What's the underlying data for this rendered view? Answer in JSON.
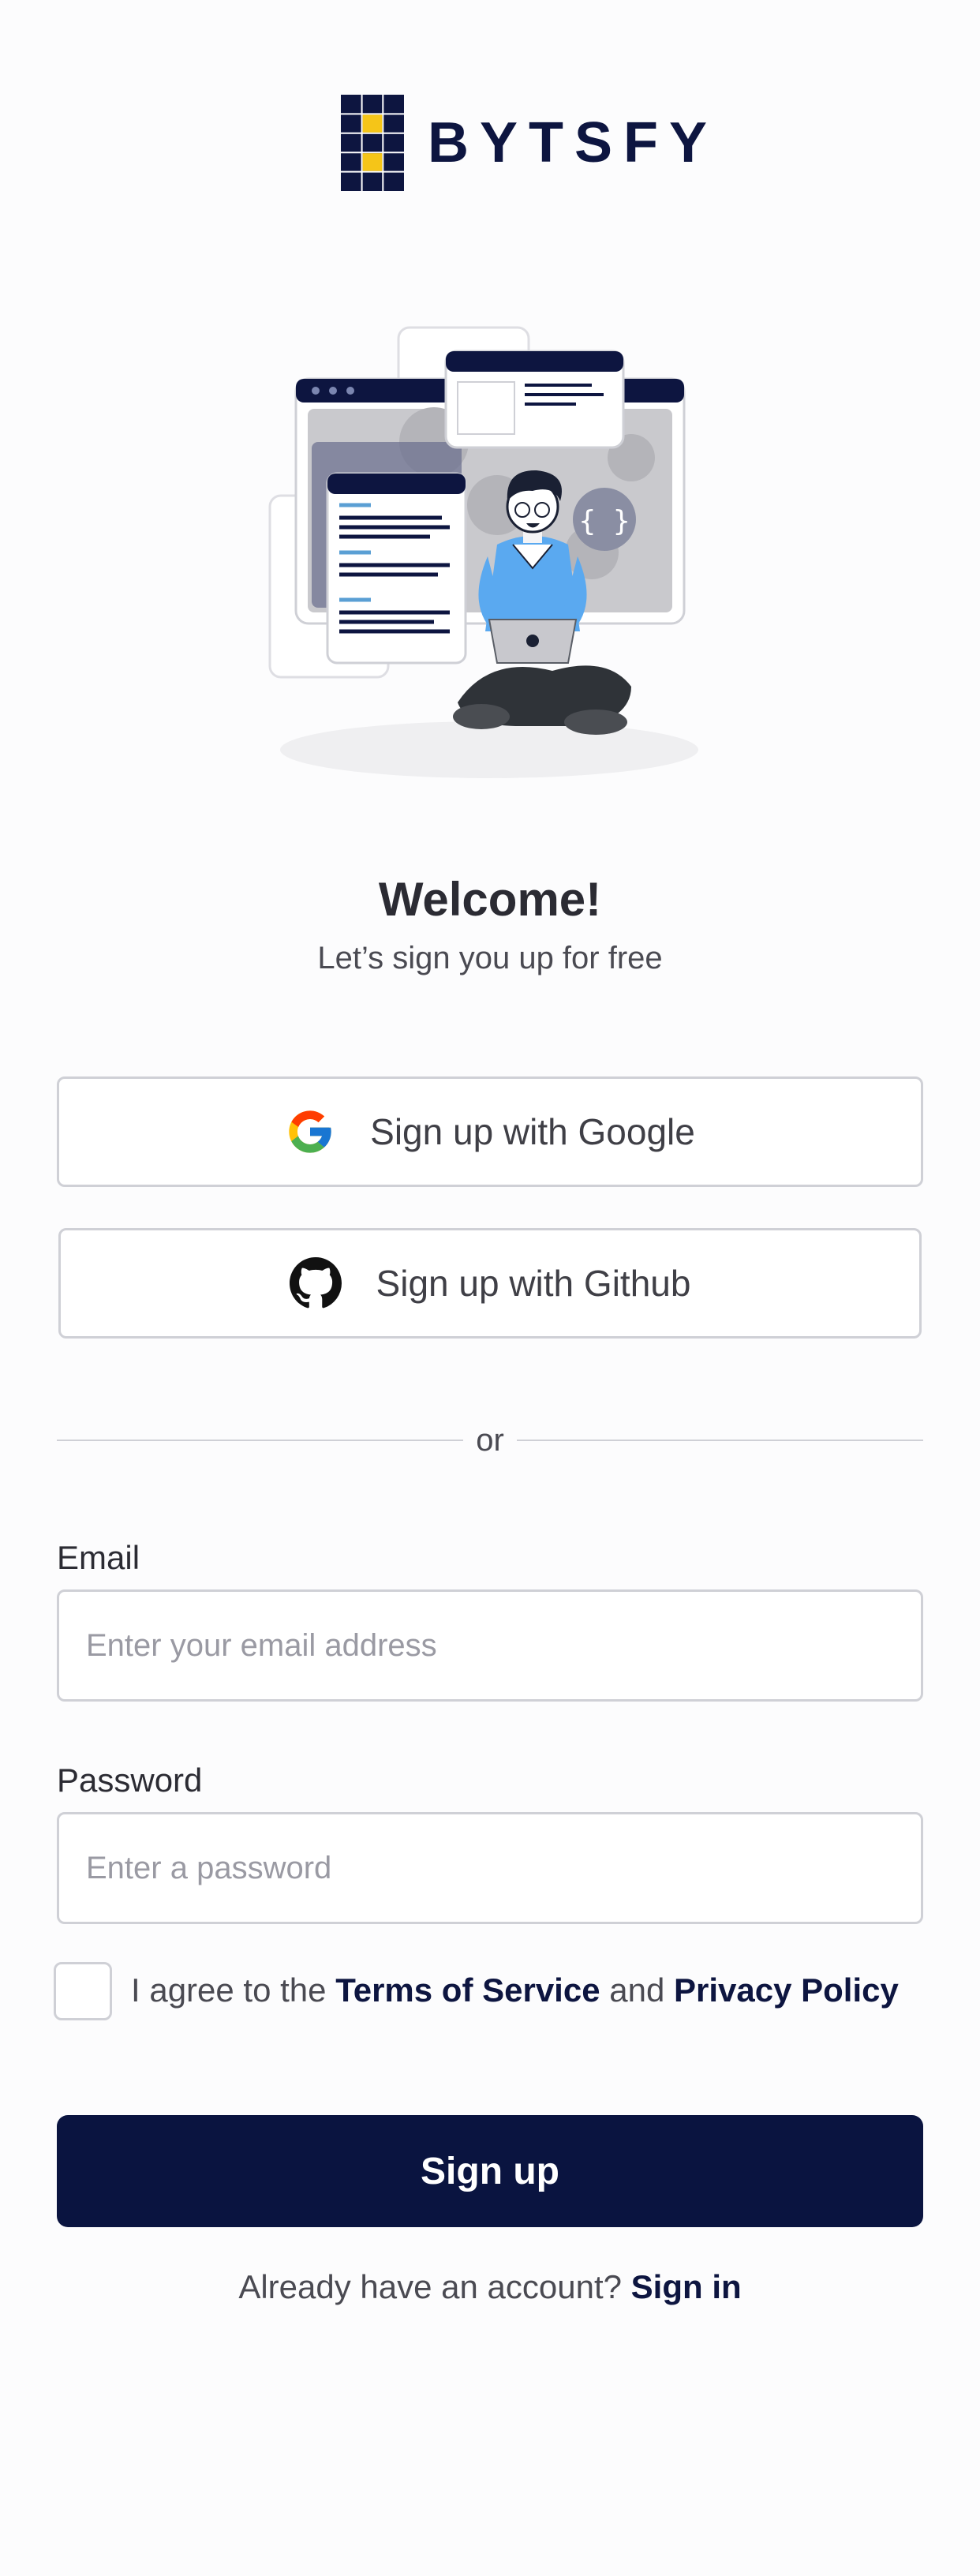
{
  "brand": {
    "name": "BYTSFY",
    "primary_color": "#0a1440",
    "accent_color": "#f5c518"
  },
  "header": {
    "title": "Welcome!",
    "subtitle": "Let’s sign you up for free"
  },
  "social": {
    "google_label": "Sign up with Google",
    "github_label": "Sign up with Github"
  },
  "divider": {
    "label": "or"
  },
  "form": {
    "email": {
      "label": "Email",
      "placeholder": "Enter your email address",
      "value": ""
    },
    "password": {
      "label": "Password",
      "placeholder": "Enter a password",
      "value": ""
    },
    "agree": {
      "prefix": "I agree to the",
      "terms": "Terms of Service",
      "and": "and",
      "privacy": "Privacy Policy",
      "checked": false
    },
    "submit_label": "Sign up"
  },
  "footer": {
    "prompt": "Already have an account?",
    "link": "Sign in"
  },
  "icons": [
    "bytsfy-logo-icon",
    "google-icon",
    "github-icon",
    "developer-illustration"
  ]
}
